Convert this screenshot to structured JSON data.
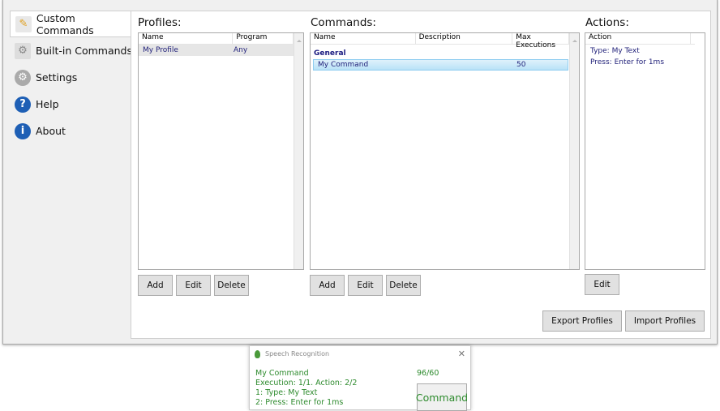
{
  "nav": [
    {
      "label": "Custom Commands",
      "icon": "pencil-document-icon"
    },
    {
      "label": "Built-in Commands",
      "icon": "document-gear-icon"
    },
    {
      "label": "Settings",
      "icon": "gear-icon"
    },
    {
      "label": "Help",
      "icon": "help-icon"
    },
    {
      "label": "About",
      "icon": "info-icon"
    }
  ],
  "profiles": {
    "title": "Profiles:",
    "columns": [
      "Name",
      "Program"
    ],
    "rows": [
      {
        "name": "My Profile",
        "program": "Any"
      }
    ],
    "buttons": [
      "Add",
      "Edit",
      "Delete"
    ]
  },
  "commands": {
    "title": "Commands:",
    "columns": [
      "Name",
      "Description",
      "Max Executions"
    ],
    "group": "General",
    "rows": [
      {
        "name": "My Command",
        "description": "",
        "max": "50"
      }
    ],
    "buttons": [
      "Add",
      "Edit",
      "Delete"
    ]
  },
  "actions": {
    "title": "Actions:",
    "columns": [
      "Action"
    ],
    "rows": [
      "Type: My Text",
      "Press: Enter for 1ms"
    ],
    "buttons": [
      "Edit"
    ]
  },
  "footer": {
    "export": "Export Profiles",
    "import": "Import Profiles"
  },
  "popup": {
    "title": "Speech Recognition",
    "lines": [
      "My Command",
      "Execution: 1/1. Action: 2/2",
      "1: Type: My Text",
      "2: Press: Enter for 1ms"
    ],
    "counter": "96/60",
    "button": "Command",
    "close": "✕"
  }
}
